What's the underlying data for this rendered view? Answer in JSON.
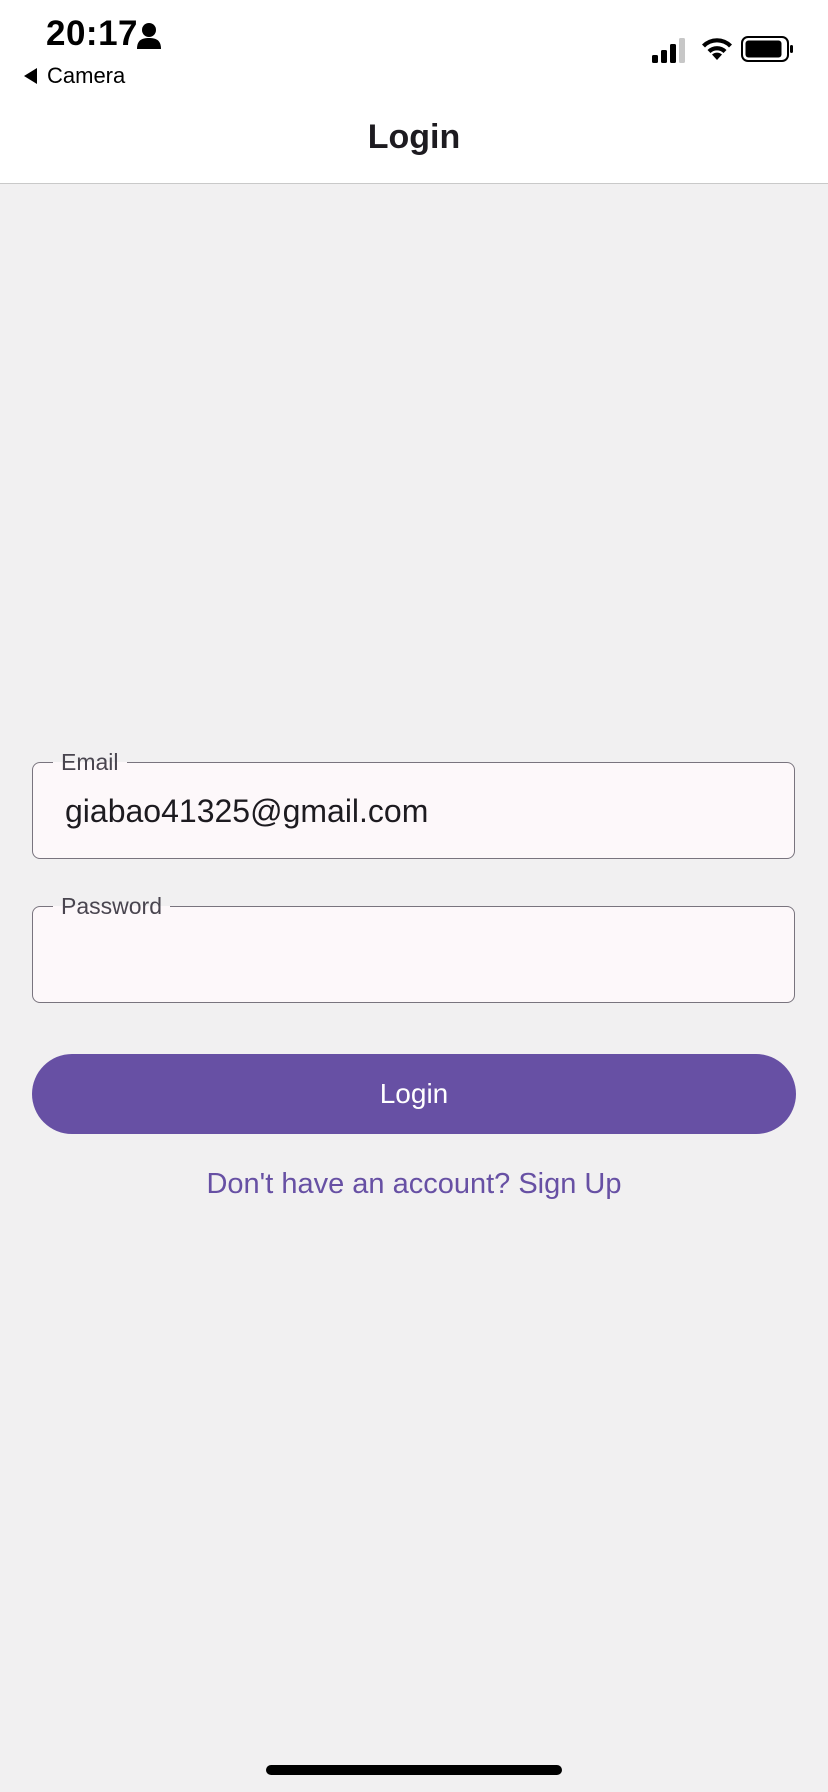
{
  "status_bar": {
    "time": "20:17",
    "back_app": "Camera",
    "icons": [
      "person-icon",
      "signal-icon",
      "wifi-icon",
      "battery-icon"
    ]
  },
  "app_bar": {
    "title": "Login"
  },
  "form": {
    "email": {
      "label": "Email",
      "value": "giabao41325@gmail.com"
    },
    "password": {
      "label": "Password",
      "value": ""
    },
    "login_button": "Login",
    "signup_link": "Don't have an account? Sign Up"
  },
  "colors": {
    "primary": "#6750a4",
    "background": "#f1f0f1",
    "field_bg": "#fdf8fa",
    "outline": "#79747e"
  }
}
